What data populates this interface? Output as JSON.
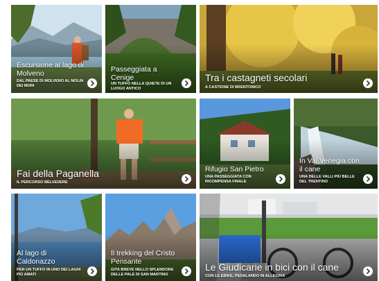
{
  "tiles": [
    {
      "title": "Escursione al lago di Molveno",
      "subtitle": "Dal paese di Molveno al Molin dei Mori"
    },
    {
      "title": "Passeggiata a Cenige",
      "subtitle": "Un tuffo nella quiete di un luogo antico"
    },
    {
      "title": "Tra i castagneti secolari",
      "subtitle": "A Castione di Brentonico"
    },
    {
      "title": "Fai della Paganella",
      "subtitle": "Il percorso belvedere"
    },
    {
      "title": "Rifugio San Pietro",
      "subtitle": "Una passeggiata con ricompensa finale"
    },
    {
      "title": "In Val Venegia con il cane",
      "subtitle": "Una delle valli più belle del Trentino"
    },
    {
      "title": "Al lago di Caldonazzo",
      "subtitle": "Per un tuffo in uno dei laghi più amati"
    },
    {
      "title": "Il trekking del Cristo Pensante",
      "subtitle": "Gita breve nello splendore delle Pale di San Martino"
    },
    {
      "title": "Le Giudicarie in bici con il cane",
      "subtitle": "Con le ebike, pedalando in allegria"
    }
  ],
  "colors": {
    "overlay_text": "#ffffff",
    "arrow_bg": "#ffffff",
    "arrow_glyph": "#333333"
  },
  "icons": {
    "arrow": "chevron-right-icon"
  }
}
